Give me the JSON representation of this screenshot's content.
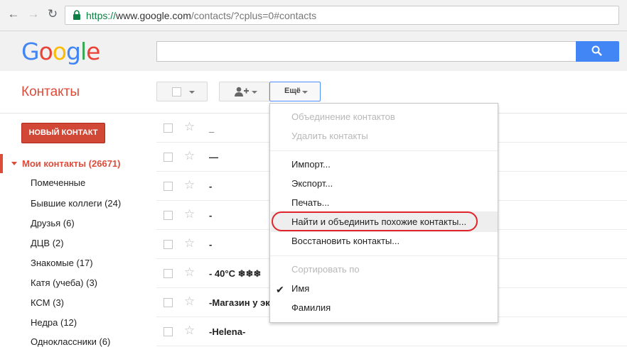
{
  "browser": {
    "url_scheme": "https://",
    "url_host": "www.google.com",
    "url_path": "/contacts/?cplus=0#contacts"
  },
  "logo": "Google",
  "app": {
    "title": "Контакты"
  },
  "toolbar": {
    "more_label": "Ещё"
  },
  "sidebar": {
    "new_contact_label": "НОВЫЙ КОНТАКТ",
    "my_contacts_label": "Мои контакты (26671)",
    "groups": [
      "Помеченные",
      "Бывшие коллеги (24)",
      "Друзья (6)",
      "ДЦВ (2)",
      "Знакомые (17)",
      "Катя (учеба) (3)",
      "КСМ (3)",
      "Недра (12)",
      "Одноклассники (6)"
    ]
  },
  "contacts": [
    "_",
    "—",
    "-",
    "-",
    "-",
    "- 40°C ❄❄❄",
    "-Магазин у эк",
    "-Helena-"
  ],
  "menu": {
    "merge_contacts": "Объединение контактов",
    "delete_contacts": "Удалить контакты",
    "import": "Импорт...",
    "export": "Экспорт...",
    "print": "Печать...",
    "find_duplicates": "Найти и объединить похожие контакты...",
    "restore": "Восстановить контакты...",
    "sort_by": "Сортировать по",
    "sort_first_name": "Имя",
    "sort_last_name": "Фамилия"
  },
  "colors": {
    "brand_red": "#dd4b39",
    "search_blue": "#4285f4",
    "highlight_ring": "#e0242b"
  }
}
